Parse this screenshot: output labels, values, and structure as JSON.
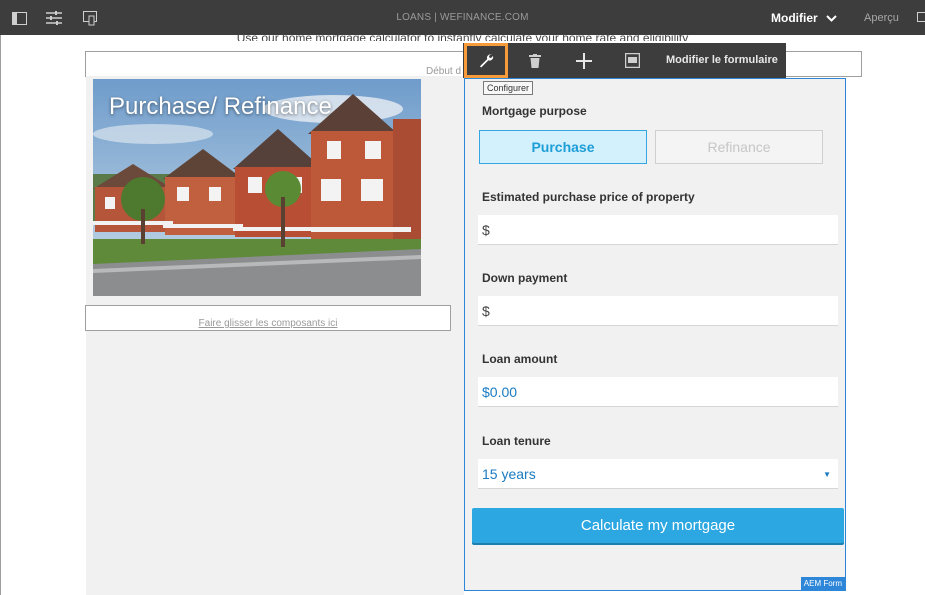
{
  "topbar": {
    "title": "LOANS | WEFINANCE.COM",
    "mode_label": "Modifier",
    "preview_label": "Aperçu",
    "icons": [
      "side-panel-icon",
      "properties-icon",
      "emulator-icon",
      "chevron-down-icon",
      "share-icon"
    ]
  },
  "page": {
    "intro_text": "Use our home mortgage calculator to instantly calculate your home rate and eligibility",
    "top_drop_hint": "Début d",
    "hero_title": "Purchase/ Refinance",
    "left_drop_hint": "Faire glisser les composants ici"
  },
  "toolbar": {
    "icons": [
      "wrench-icon",
      "trash-icon",
      "plus-icon",
      "form-container-icon"
    ],
    "edit_form_label": "Modifier le formulaire",
    "tooltip": "Configurer",
    "selected_color": "#f79a39"
  },
  "form": {
    "purpose_label": "Mortgage purpose",
    "purchase_label": "Purchase",
    "refinance_label": "Refinance",
    "price_label": "Estimated purchase price of property",
    "price_value": "$",
    "down_label": "Down payment",
    "down_value": "$",
    "loan_label": "Loan amount",
    "loan_value": "$0.00",
    "tenure_label": "Loan tenure",
    "tenure_value": "15 years",
    "calc_label": "Calculate my mortgage",
    "tag": "AEM Form",
    "accent_color": "#2da7e1"
  }
}
